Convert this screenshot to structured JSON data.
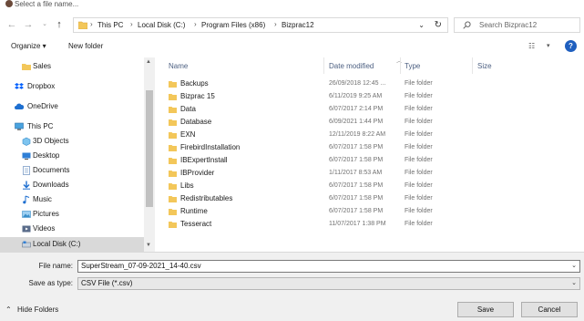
{
  "titlebar": {
    "title": "Select a file name..."
  },
  "navbar": {
    "crumbs": [
      "This PC",
      "Local Disk (C:)",
      "Program Files (x86)",
      "Bizprac12"
    ],
    "search_placeholder": "Search Bizprac12"
  },
  "toolbar": {
    "organize": "Organize ▾",
    "new_folder": "New folder",
    "help": "?"
  },
  "nav": {
    "items": [
      {
        "label": "Sales",
        "icon": "folder-icon"
      },
      {
        "label": "Dropbox",
        "icon": "dropbox-icon"
      },
      {
        "label": "OneDrive",
        "icon": "cloud-icon"
      },
      {
        "label": "This PC",
        "icon": "computer-icon"
      },
      {
        "label": "3D Objects",
        "icon": "cube-icon"
      },
      {
        "label": "Desktop",
        "icon": "desktop-icon"
      },
      {
        "label": "Documents",
        "icon": "documents-icon"
      },
      {
        "label": "Downloads",
        "icon": "download-icon"
      },
      {
        "label": "Music",
        "icon": "music-icon"
      },
      {
        "label": "Pictures",
        "icon": "pictures-icon"
      },
      {
        "label": "Videos",
        "icon": "video-icon"
      },
      {
        "label": "Local Disk (C:)",
        "icon": "drive-icon"
      }
    ]
  },
  "list": {
    "columns": {
      "name": "Name",
      "date": "Date modified",
      "type": "Type",
      "size": "Size"
    },
    "rows": [
      {
        "name": "Backups",
        "date": "26/09/2018 12:45 ...",
        "type": "File folder"
      },
      {
        "name": "Bizprac 15",
        "date": "6/11/2019 9:25 AM",
        "type": "File folder"
      },
      {
        "name": "Data",
        "date": "6/07/2017 2:14 PM",
        "type": "File folder"
      },
      {
        "name": "Database",
        "date": "6/09/2021 1:44 PM",
        "type": "File folder"
      },
      {
        "name": "EXN",
        "date": "12/11/2019 8:22 AM",
        "type": "File folder"
      },
      {
        "name": "FirebirdInstallation",
        "date": "6/07/2017 1:58 PM",
        "type": "File folder"
      },
      {
        "name": "IBExpertInstall",
        "date": "6/07/2017 1:58 PM",
        "type": "File folder"
      },
      {
        "name": "IBProvider",
        "date": "1/11/2017 8:53 AM",
        "type": "File folder"
      },
      {
        "name": "Libs",
        "date": "6/07/2017 1:58 PM",
        "type": "File folder"
      },
      {
        "name": "Redistributables",
        "date": "6/07/2017 1:58 PM",
        "type": "File folder"
      },
      {
        "name": "Runtime",
        "date": "6/07/2017 1:58 PM",
        "type": "File folder"
      },
      {
        "name": "Tesseract",
        "date": "11/07/2017 1:38 PM",
        "type": "File folder"
      }
    ]
  },
  "bottom": {
    "file_name_label": "File name:",
    "file_name_value": "SuperStream_07-09-2021_14-40.csv",
    "save_as_label": "Save as type:",
    "save_as_value": "CSV File (*.csv)",
    "hide_folders": "Hide Folders",
    "save": "Save",
    "cancel": "Cancel"
  },
  "colors": {
    "folder": "#f3c75a",
    "accent": "#1f5fbf",
    "selected": "#d9d9d9"
  }
}
